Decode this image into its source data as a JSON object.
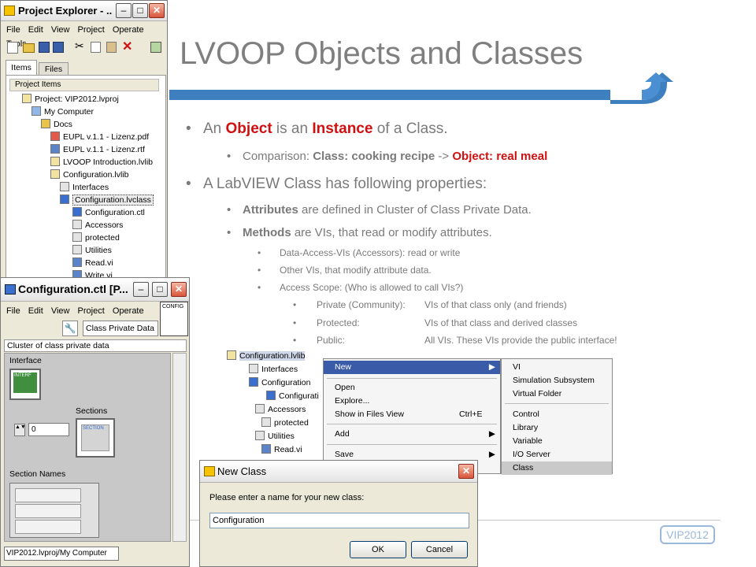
{
  "slide": {
    "title": "LVOOP Objects and Classes",
    "logo": "VIP2012",
    "bullets": [
      {
        "parts": [
          "An ",
          "Object",
          " is an ",
          "Instance",
          " of a Class."
        ]
      },
      {
        "parts": [
          "Comparison: ",
          "Class: cooking recipe",
          " -> ",
          "Object: real meal"
        ]
      },
      {
        "text": "A LabVIEW Class has following properties:"
      },
      {
        "parts": [
          "Attributes",
          " are defined in Cluster of Class Private Data."
        ]
      },
      {
        "parts": [
          "Methods",
          " are VIs, that read or modify attributes."
        ]
      },
      {
        "text": "Data-Access-VIs (Accessors): read or write"
      },
      {
        "text": "Other VIs, that modify attribute data."
      },
      {
        "text": "Access Scope: (Who is allowed to call VIs?)"
      },
      {
        "label": "Private (Community):",
        "value": "VIs of that class only (and friends)"
      },
      {
        "label": "Protected:",
        "value": "VIs of that class and derived classes"
      },
      {
        "label": "Public:",
        "value": "All VIs. These VIs provide the public interface!"
      }
    ],
    "accent_color": "#3e7fbf",
    "highlight_color": "#d01010"
  },
  "project_explorer": {
    "title": "Project Explorer - ...",
    "menu": [
      "File",
      "Edit",
      "View",
      "Project",
      "Operate",
      "Tools"
    ],
    "tabs": [
      "Items",
      "Files"
    ],
    "tree_header": "Project Items",
    "tree": [
      "Project: VIP2012.lvproj",
      "My Computer",
      "Docs",
      "EUPL v.1.1 - Lizenz.pdf",
      "EUPL v.1.1 - Lizenz.rtf",
      "LVOOP Introduction.lvlib",
      "Configuration.lvlib",
      "Interfaces",
      "Configuration.lvclass",
      "Configuration.ctl",
      "Accessors",
      "protected",
      "Utilities",
      "Read.vi",
      "Write.vi"
    ]
  },
  "ctl_window": {
    "title": "Configuration.ctl [P...",
    "menu": [
      "File",
      "Edit",
      "View",
      "Project",
      "Operate"
    ],
    "toolbar_button": "Class Private Data",
    "badge": "CONFIG",
    "cluster_label": "Cluster of class private data",
    "interface_label": "Interface",
    "interface_badge": "INTERF",
    "sections_label": "Sections",
    "sections_badge": "SECTION",
    "numeric_value": "0",
    "section_names_label": "Section Names",
    "status_path": "VIP2012.lvproj/My Computer"
  },
  "context_tree": {
    "items": [
      "Configuration.lvlib",
      "Interfaces",
      "Configuration",
      "Configurati",
      "Accessors",
      "protected",
      "Utilities",
      "Read.vi"
    ]
  },
  "context_menu": {
    "items": [
      {
        "label": "New",
        "arrow": true,
        "selected": true
      },
      {
        "label": "Open"
      },
      {
        "label": "Explore..."
      },
      {
        "label": "Show in Files View",
        "shortcut": "Ctrl+E"
      },
      {
        "label": "Add",
        "arrow": true
      },
      {
        "label": "Save",
        "arrow": true
      }
    ],
    "submenu": [
      "VI",
      "Simulation Subsystem",
      "Virtual Folder",
      "Control",
      "Library",
      "Variable",
      "I/O Server",
      "Class"
    ]
  },
  "new_class_dialog": {
    "title": "New Class",
    "prompt": "Please enter a name for your new class:",
    "value": "Configuration",
    "ok": "OK",
    "cancel": "Cancel"
  }
}
